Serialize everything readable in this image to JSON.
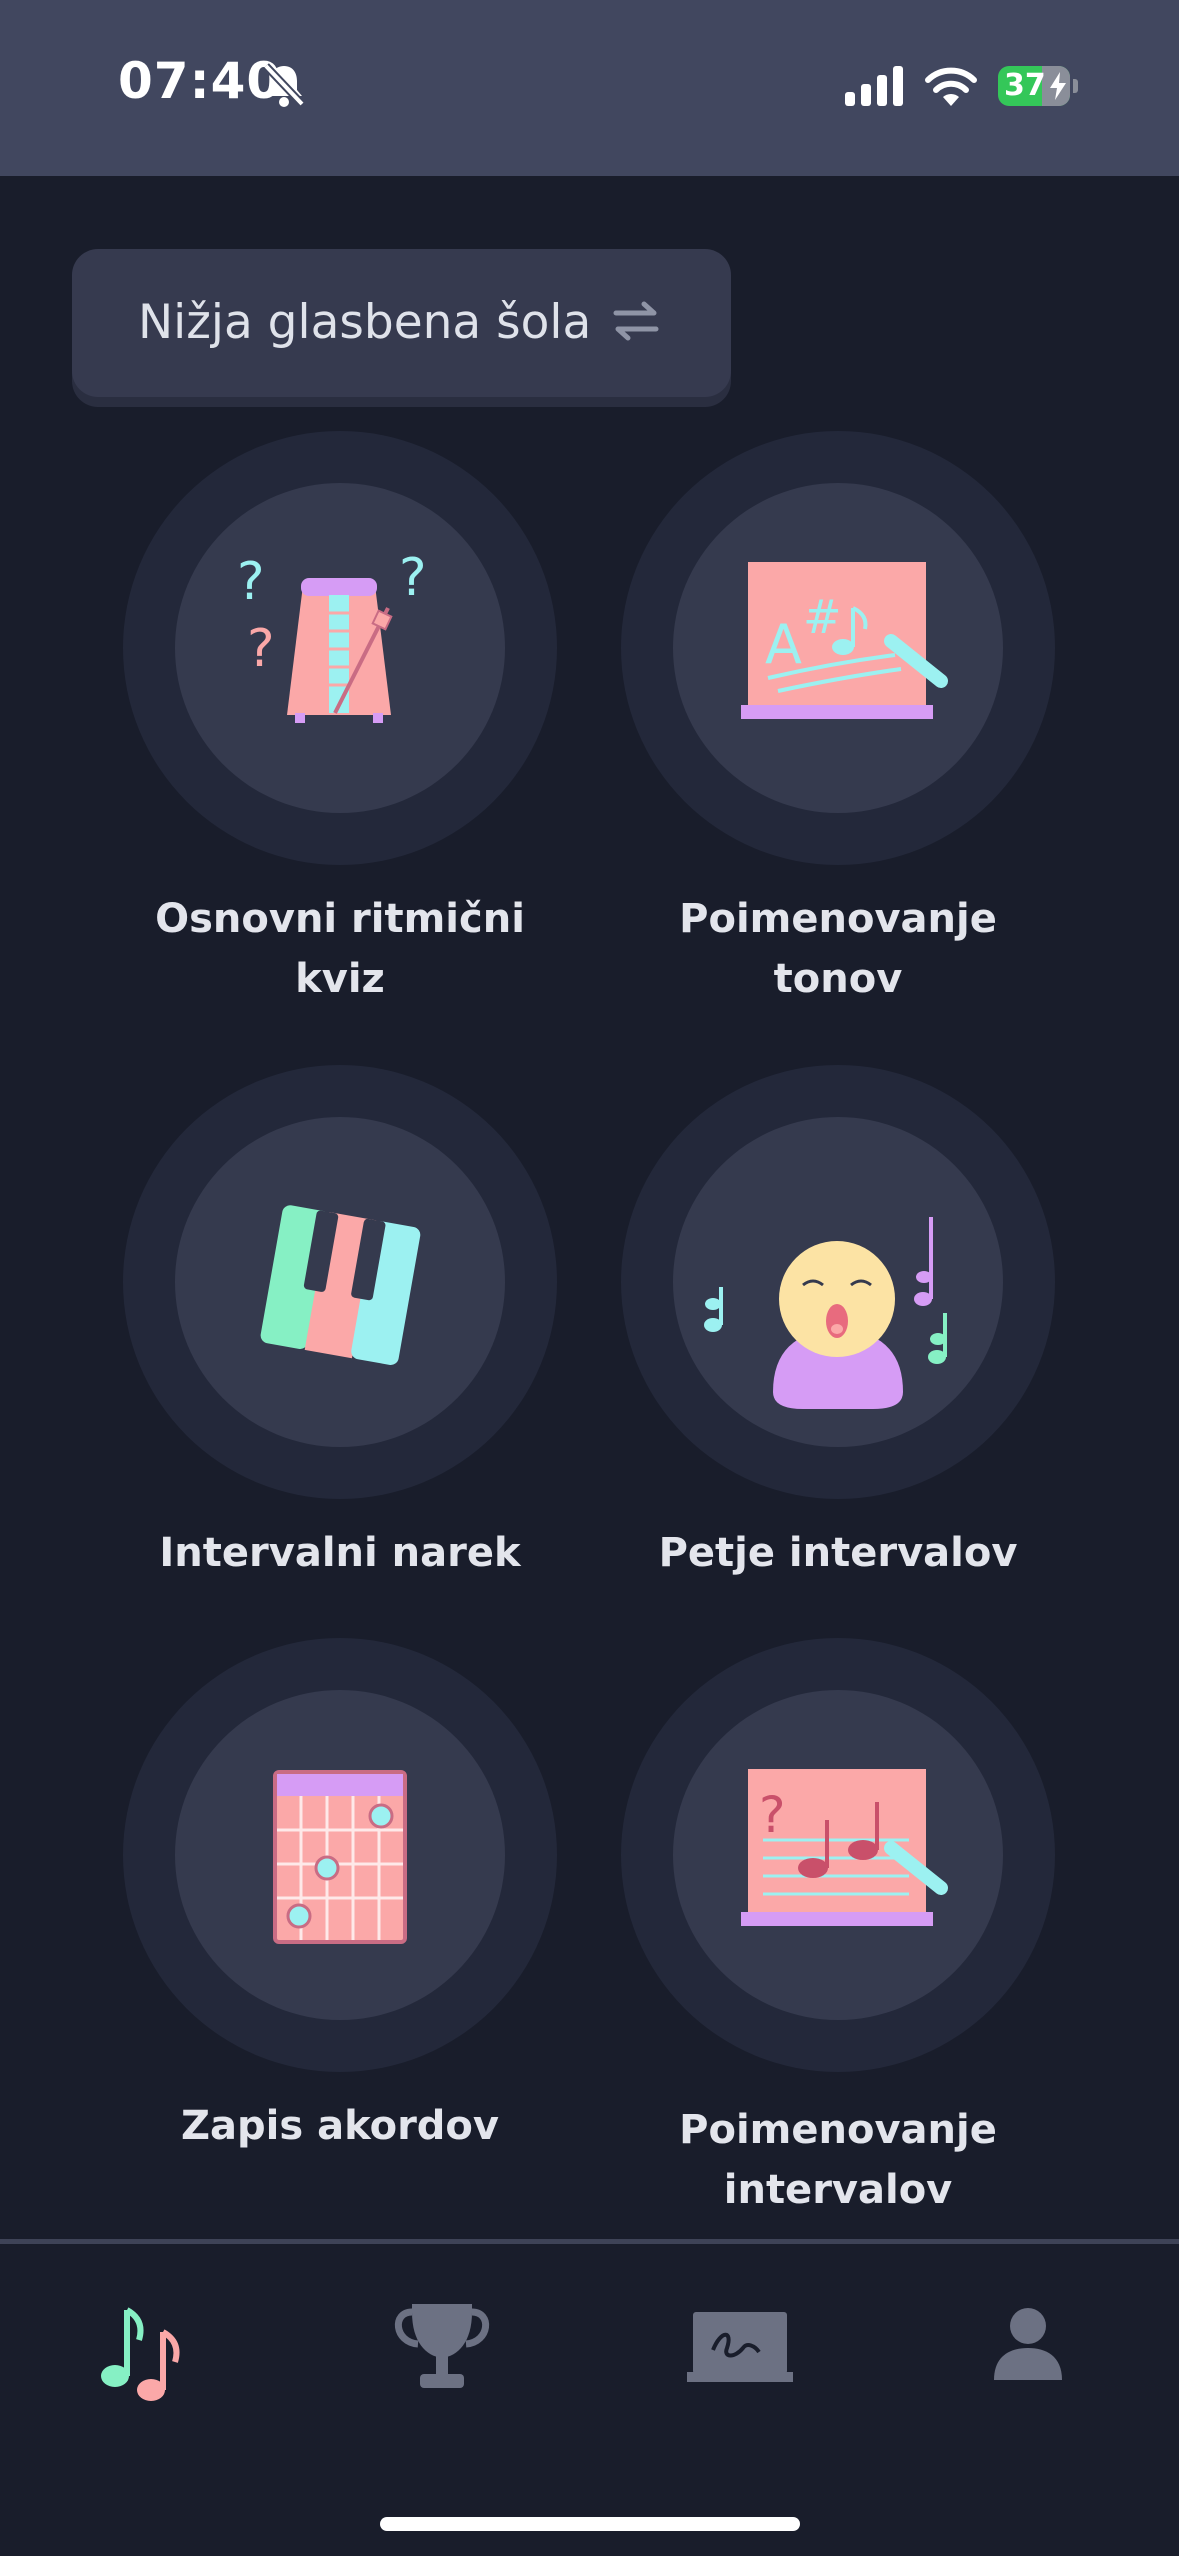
{
  "status_bar": {
    "time": "07:40",
    "battery": "37",
    "icons": [
      "bell-slash-icon",
      "signal-icon",
      "wifi-icon",
      "battery-charging-icon"
    ]
  },
  "selector": {
    "label": "Nižja glasbena šola",
    "icon": "swap-arrows-icon"
  },
  "tiles": [
    {
      "label": "Osnovni ritmični kviz",
      "icon": "metronome-icon"
    },
    {
      "label": "Poimenovanje tonov",
      "icon": "chalkboard-notes-icon"
    },
    {
      "label": "Intervalni narek",
      "icon": "piano-keys-icon"
    },
    {
      "label": "Petje intervalov",
      "icon": "singer-icon"
    },
    {
      "label": "Zapis akordov",
      "icon": "chord-chart-icon"
    },
    {
      "label": "Poimenovanje intervalov",
      "icon": "chalkboard-intervals-icon"
    }
  ],
  "tabbar": [
    {
      "icon": "music-notes-icon",
      "active": true
    },
    {
      "icon": "trophy-icon",
      "active": false
    },
    {
      "icon": "blackboard-icon",
      "active": false
    },
    {
      "icon": "person-icon",
      "active": false
    }
  ],
  "colors": {
    "background": "#191d2b",
    "status_bar": "#41475f",
    "card": "#353a4e",
    "pink": "#fba8a8",
    "mint": "#86f0c4",
    "cyan": "#9cf1f1",
    "lavender": "#d69cf5",
    "battery_green": "#34c759"
  }
}
